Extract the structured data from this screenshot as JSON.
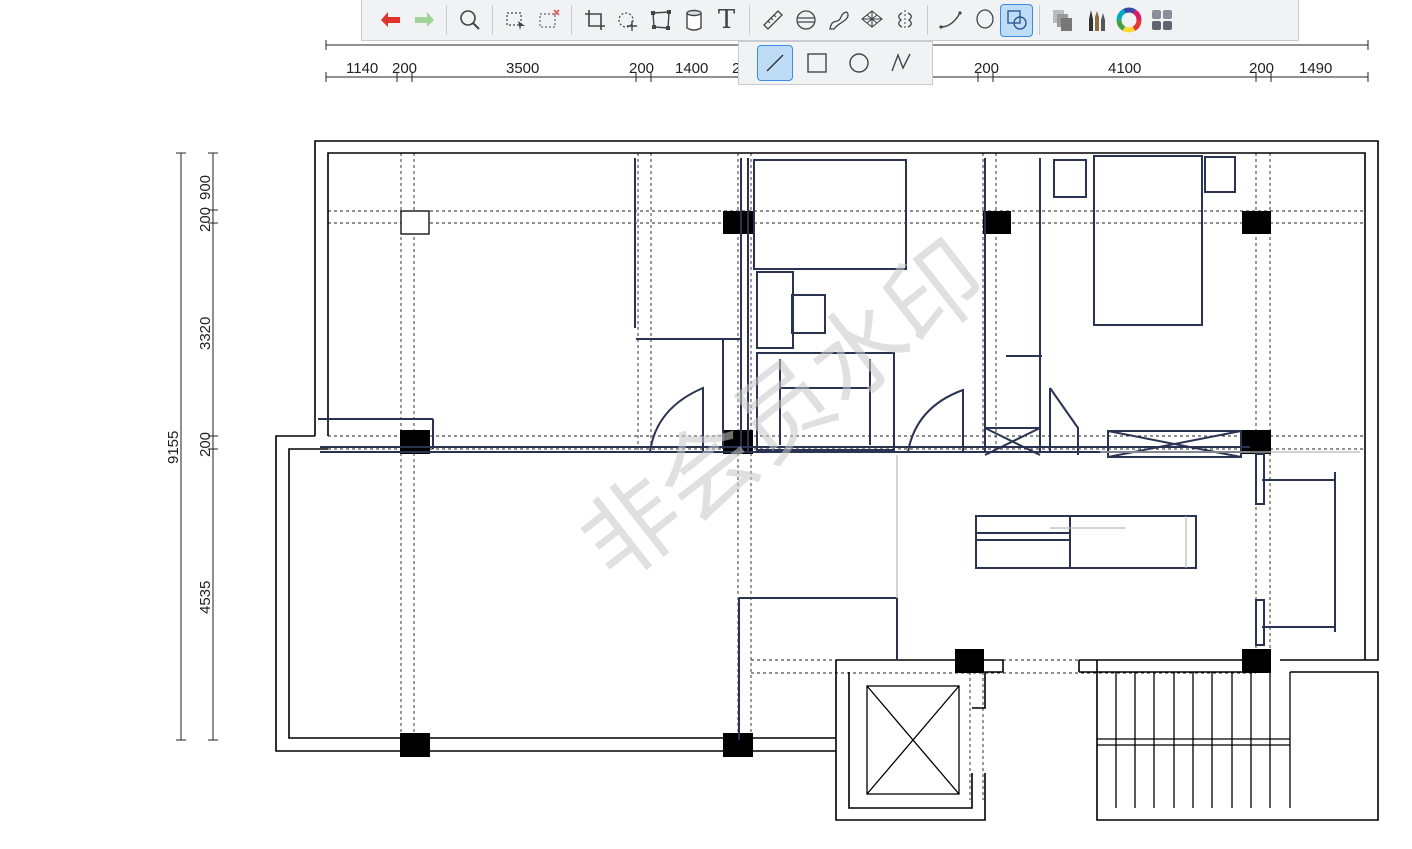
{
  "toolbar": {
    "tools": [
      {
        "id": "undo",
        "icon": "undo-icon"
      },
      {
        "id": "redo",
        "icon": "redo-icon"
      },
      {
        "id": "zoom",
        "icon": "magnifier-icon"
      },
      {
        "id": "select",
        "icon": "selection-icon"
      },
      {
        "id": "deselect",
        "icon": "clear-selection-icon"
      },
      {
        "id": "crop",
        "icon": "crop-icon"
      },
      {
        "id": "transform",
        "icon": "transform-icon"
      },
      {
        "id": "perspective",
        "icon": "distort-icon"
      },
      {
        "id": "fill",
        "icon": "bucket-icon"
      },
      {
        "id": "text",
        "icon": "text-icon",
        "glyph": "T"
      },
      {
        "id": "ruler",
        "icon": "ruler-icon"
      },
      {
        "id": "ellipse-guide",
        "icon": "ellipse-guide-icon"
      },
      {
        "id": "french-curve",
        "icon": "french-curve-icon"
      },
      {
        "id": "perspective-grid",
        "icon": "perspective-grid-icon"
      },
      {
        "id": "symmetry",
        "icon": "symmetry-icon"
      },
      {
        "id": "curve",
        "icon": "curve-icon"
      },
      {
        "id": "lasso",
        "icon": "lasso-icon"
      },
      {
        "id": "shape",
        "icon": "shape-icon",
        "active": true
      },
      {
        "id": "layers",
        "icon": "layers-icon"
      },
      {
        "id": "brushes",
        "icon": "brushes-icon"
      },
      {
        "id": "color",
        "icon": "color-wheel-icon"
      },
      {
        "id": "settings",
        "icon": "grid-menu-icon"
      }
    ],
    "shape_options": [
      {
        "id": "line",
        "icon": "line-icon",
        "active": true
      },
      {
        "id": "rectangle",
        "icon": "rectangle-icon"
      },
      {
        "id": "ellipse",
        "icon": "circle-icon"
      },
      {
        "id": "polyline",
        "icon": "polyline-icon"
      }
    ]
  },
  "plan": {
    "top_dims": [
      "1140",
      "200",
      "3500",
      "200",
      "1400",
      "2",
      "200",
      "4100",
      "200",
      "1490"
    ],
    "left_dims": {
      "total": "9155",
      "segments": [
        "900",
        "200",
        "3320",
        "200",
        "4535"
      ]
    },
    "watermark": "非会员水印",
    "colors": {
      "wall": "#000000",
      "sketch": "#2a3452",
      "column": "#000000"
    }
  }
}
